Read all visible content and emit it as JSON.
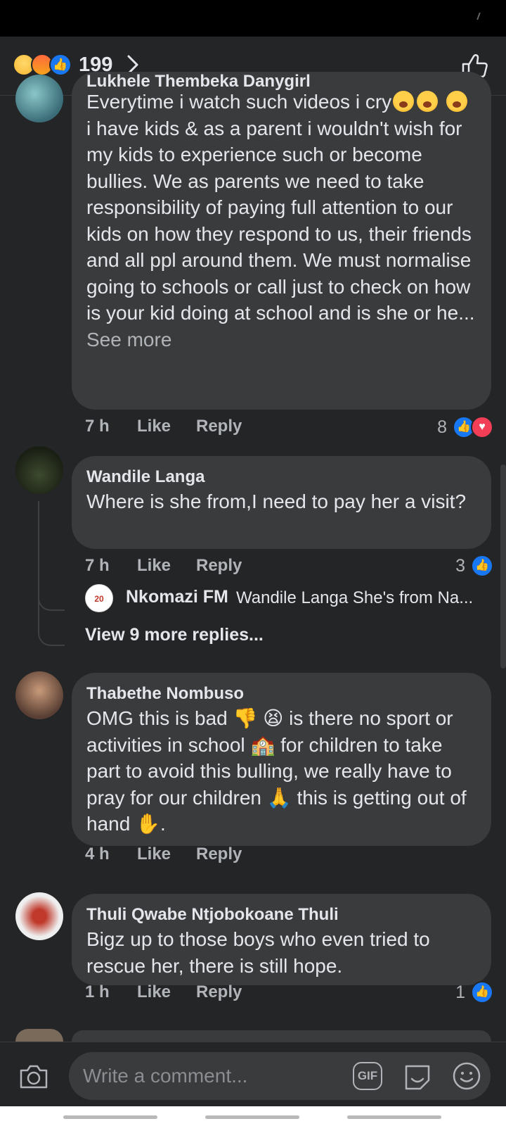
{
  "reactions_header": {
    "count": "199"
  },
  "comments": [
    {
      "author": "Lukhele Thembeka Danygirl",
      "text_parts": [
        "Everytime  i watch such videos i cry",
        "i have kids & as a parent i wouldn't wish for my kids to experience  such or become bullies.  We as parents we need to take responsibility  of paying full attention to our kids on how they respond  to us, their friends and all ppl around them. We must normalise going to schools or call just to check on how  is your  kid doing at school and is she or he..."
      ],
      "see_more": "See more",
      "time": "7 h",
      "like": "Like",
      "reply": "Reply",
      "reaction_count": "8"
    },
    {
      "author": "Wandile Langa",
      "text": "Where is she from,I need to pay her a visit?",
      "time": "7 h",
      "like": "Like",
      "reply": "Reply",
      "reaction_count": "3",
      "reply_preview": {
        "author": "Nkomazi FM",
        "snippet": "Wandile Langa She's from Na...",
        "avatar_text": "20"
      },
      "view_more": "View 9 more replies..."
    },
    {
      "author": "Thabethe Nombuso",
      "text_parts": [
        "OMG this is bad",
        "is there no sport or activities in school",
        "for children to take part to avoid this bulling, we really have to pray for our children",
        "this is getting out of hand",
        "."
      ],
      "time": "4 h",
      "like": "Like",
      "reply": "Reply"
    },
    {
      "author": "Thuli Qwabe Ntjobokoane Thuli",
      "text": "Bigz up to those boys who even tried to rescue her, there is still hope.",
      "time": "1 h",
      "like": "Like",
      "reply": "Reply",
      "reaction_count": "1"
    }
  ],
  "composer": {
    "placeholder": "Write a comment...",
    "gif_label": "GIF"
  },
  "icons": {
    "thumbs_down": "👎",
    "tired_face": "😫",
    "school": "🏫",
    "folded_hands": "🙏",
    "raised_hand": "✋",
    "like_glyph": "👍",
    "love_glyph": "♥"
  },
  "colors": {
    "accent": "#1877f2",
    "love": "#f33e58",
    "bubble": "#3a3b3c",
    "background": "#242526"
  }
}
